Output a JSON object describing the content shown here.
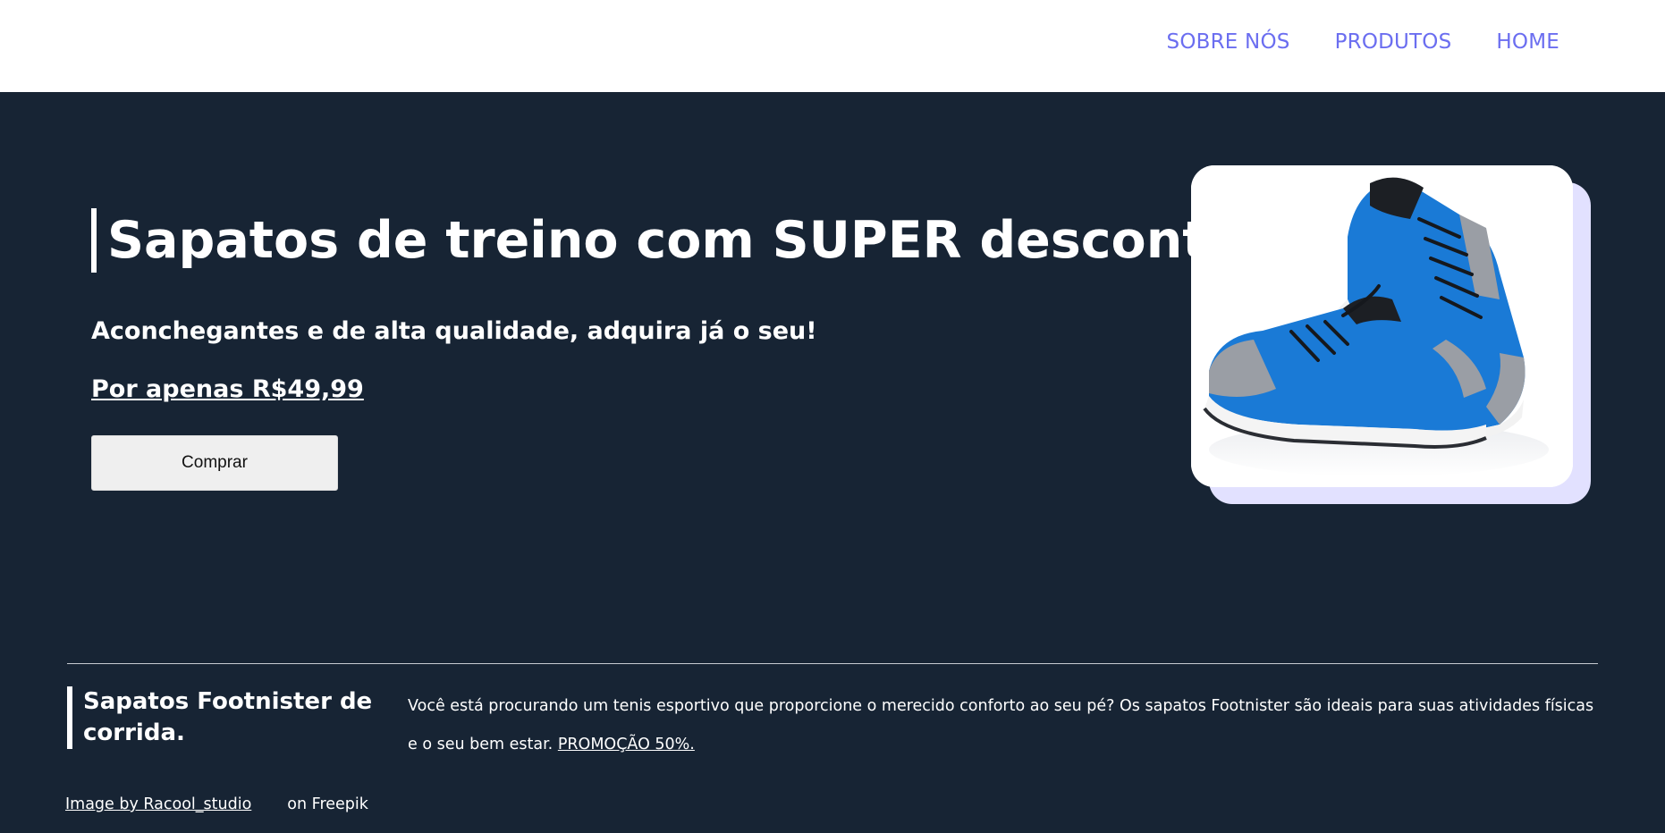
{
  "nav": {
    "items": [
      {
        "label": "SOBRE NÓS"
      },
      {
        "label": "PRODUTOS"
      },
      {
        "label": "HOME"
      }
    ]
  },
  "hero": {
    "title": "Sapatos de treino com SUPER desconto!",
    "subtitle": "Aconchegantes e de alta qualidade, adquira já o seu!",
    "price": "Por apenas R$49,99",
    "buy_label": "Comprar",
    "image": "blue-running-shoes-photo"
  },
  "feature": {
    "title": "Sapatos Footnister de corrida.",
    "text": "Você está procurando um tenis esportivo que proporcione o merecido conforto ao seu pé? Os sapatos Footnister são ideais para suas atividades físicas e o seu bem estar.",
    "promo_link": "PROMOÇÃO 50%."
  },
  "credit": {
    "link": "Image by Racool_studio",
    "suffix": "on Freepik"
  },
  "colors": {
    "nav_link": "#6b6ef0",
    "background": "#172434",
    "card_shadow": "#e2e1ff",
    "shoe_blue": "#1a7ad6"
  }
}
